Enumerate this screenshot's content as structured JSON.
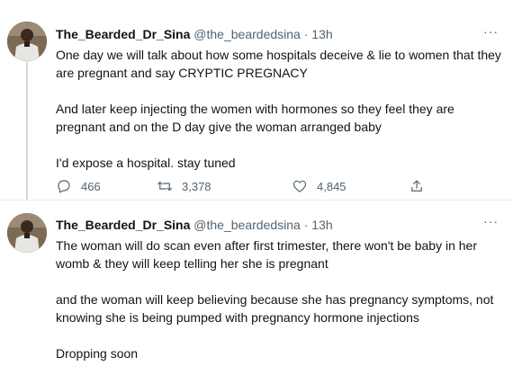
{
  "tweets": [
    {
      "author_name": "The_Bearded_Dr_Sina",
      "handle": "@the_beardedsina",
      "separator": "·",
      "time": "13h",
      "more": "···",
      "paragraphs": [
        "One day we will talk about how some hospitals deceive & lie to women that they are pregnant and say CRYPTIC PREGNACY",
        "And later keep injecting the women with hormones so they feel they are pregnant and on the D day give the woman arranged baby",
        "I'd expose a hospital. stay tuned"
      ],
      "replies": "466",
      "retweets": "3,378",
      "likes": "4,845"
    },
    {
      "author_name": "The_Bearded_Dr_Sina",
      "handle": "@the_beardedsina",
      "separator": "·",
      "time": "13h",
      "more": "···",
      "paragraphs": [
        "The woman will do scan even after first trimester, there won't be baby in her womb & they will keep telling her she is pregnant",
        "and the woman will keep believing because she has pregnancy symptoms, not knowing she is being pumped with pregnancy hormone injections",
        "Dropping soon"
      ]
    }
  ],
  "icons": {
    "reply": "reply-icon",
    "retweet": "retweet-icon",
    "like": "heart-icon",
    "share": "share-icon",
    "more": "more-icon"
  },
  "colors": {
    "text": "#0f1419",
    "secondary": "#536471",
    "divider": "#e9ecef"
  }
}
